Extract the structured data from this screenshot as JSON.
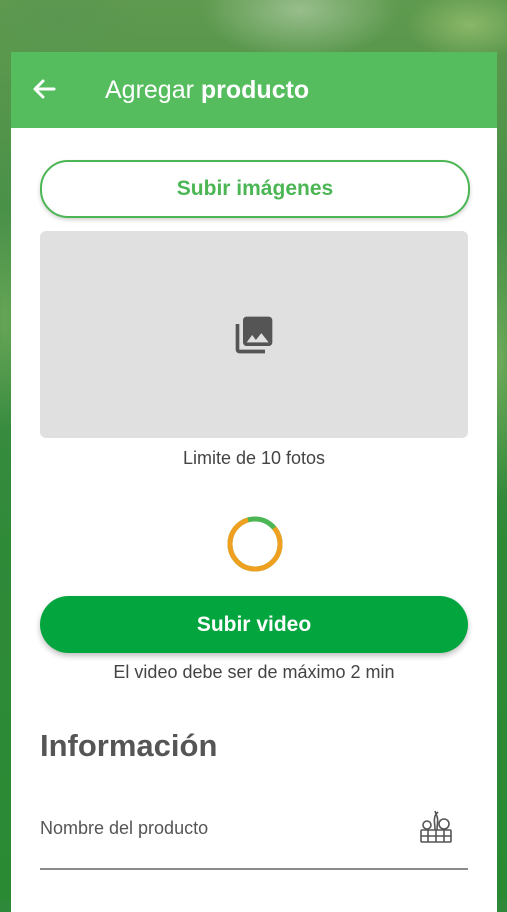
{
  "header": {
    "title_regular": "Agregar ",
    "title_bold": "producto"
  },
  "images": {
    "upload_label": "Subir imágenes",
    "limit_text": "Limite de 10 fotos"
  },
  "video": {
    "upload_label": "Subir video",
    "hint_text": "El video debe ser de máximo 2 min"
  },
  "info": {
    "section_title": "Información",
    "product_name_label": "Nombre del producto"
  },
  "icons": {
    "back": "arrow-left-icon",
    "gallery": "photo-library-icon",
    "loading": "loading-spinner",
    "product": "produce-basket-icon"
  },
  "colors": {
    "appbar": "#55bd5e",
    "accent": "#4cb655",
    "primary_button": "#03a53f",
    "spinner_track": "#4cb655",
    "spinner_arc": "#f0a020",
    "placeholder_box": "#e0e0e0"
  }
}
